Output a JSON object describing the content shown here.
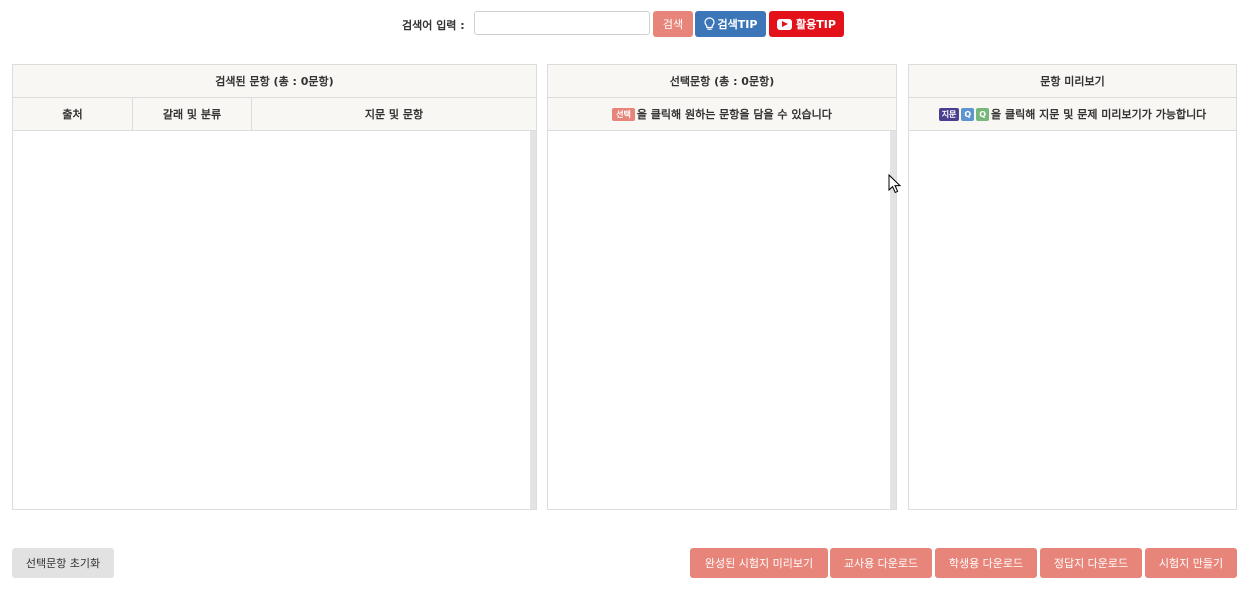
{
  "search": {
    "label": "검색어 입력 :",
    "input_value": "",
    "search_button": "검색",
    "tip_button": "검색TIP",
    "youtube_button": "활용TIP"
  },
  "panels": {
    "results": {
      "title": "검색된 문항 (총 : 0문항)",
      "columns": [
        "출처",
        "갈래 및 분류",
        "지문 및 문항"
      ]
    },
    "selected": {
      "title": "선택문항 (총 : 0문항)",
      "tag_label": "선택",
      "hint": "을 클릭해 원하는 문항을 담을 수 있습니다"
    },
    "preview": {
      "title": "문항 미리보기",
      "tags": [
        "지문",
        "Q",
        "Q"
      ],
      "hint": "을 클릭해 지문 및 문제 미리보기가 가능합니다"
    }
  },
  "bottom": {
    "reset_button": "선택문항 초기화",
    "actions": [
      "완성된 시험지 미리보기",
      "교사용 다운로드",
      "학생용 다운로드",
      "정답지 다운로드",
      "시험지 만들기"
    ]
  },
  "colors": {
    "accent": "#e8857a",
    "tip_blue": "#3d76b8",
    "youtube_red": "#e3111a",
    "header_bg": "#f8f7f4"
  }
}
